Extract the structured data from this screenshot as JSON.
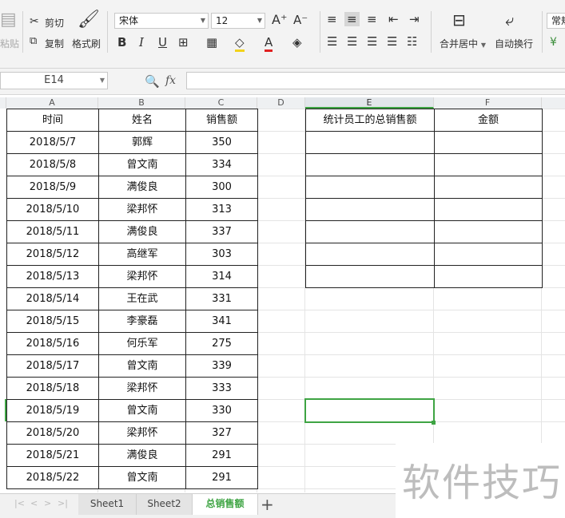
{
  "toolbar": {
    "paste": "粘贴",
    "cut": "剪切",
    "copy": "复制",
    "format_painter": "格式刷",
    "font_name": "宋体",
    "font_size": "12",
    "merge_center": "合并居中",
    "wrap_text": "自动换行",
    "number_format": "常规"
  },
  "formula_bar": {
    "name_box": "E14",
    "fx": "fx",
    "formula": ""
  },
  "columns": [
    "A",
    "B",
    "C",
    "D",
    "E",
    "F"
  ],
  "table": {
    "headers": [
      "时间",
      "姓名",
      "销售额"
    ],
    "rows": [
      [
        "2018/5/7",
        "郭辉",
        "350"
      ],
      [
        "2018/5/8",
        "曾文南",
        "334"
      ],
      [
        "2018/5/9",
        "满俊良",
        "300"
      ],
      [
        "2018/5/10",
        "梁邦怀",
        "313"
      ],
      [
        "2018/5/11",
        "满俊良",
        "337"
      ],
      [
        "2018/5/12",
        "高继军",
        "303"
      ],
      [
        "2018/5/13",
        "梁邦怀",
        "314"
      ],
      [
        "2018/5/14",
        "王在武",
        "331"
      ],
      [
        "2018/5/15",
        "李豪磊",
        "341"
      ],
      [
        "2018/5/16",
        "何乐军",
        "275"
      ],
      [
        "2018/5/17",
        "曾文南",
        "339"
      ],
      [
        "2018/5/18",
        "梁邦怀",
        "333"
      ],
      [
        "2018/5/19",
        "曾文南",
        "330"
      ],
      [
        "2018/5/20",
        "梁邦怀",
        "327"
      ],
      [
        "2018/5/21",
        "满俊良",
        "291"
      ],
      [
        "2018/5/22",
        "曾文南",
        "291"
      ]
    ]
  },
  "summary": {
    "headers": [
      "统计员工的总销售额",
      "金额"
    ],
    "empty_rows": 7
  },
  "sheet_tabs": [
    "Sheet1",
    "Sheet2",
    "总销售额"
  ],
  "active_sheet": "总销售额",
  "watermark": "软件技巧",
  "colors": {
    "accent": "#3ea443",
    "grid": "#e4e4e4",
    "border": "#222222"
  }
}
